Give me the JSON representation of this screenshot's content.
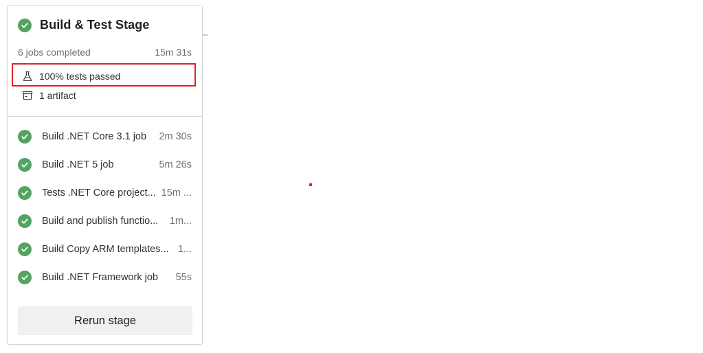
{
  "stage": {
    "title": "Build & Test Stage",
    "status": "succeeded",
    "summary": "6 jobs completed",
    "total_duration": "15m 31s",
    "tests_passed": "100% tests passed",
    "artifacts": "1 artifact"
  },
  "jobs": [
    {
      "name": "Build .NET Core 3.1 job",
      "duration": "2m 30s",
      "status": "succeeded"
    },
    {
      "name": "Build .NET 5 job",
      "duration": "5m 26s",
      "status": "succeeded"
    },
    {
      "name": "Tests .NET Core project...",
      "duration": "15m ...",
      "status": "succeeded"
    },
    {
      "name": "Build and publish functio...",
      "duration": "1m...",
      "status": "succeeded"
    },
    {
      "name": "Build Copy ARM templates...",
      "duration": "1...",
      "status": "succeeded"
    },
    {
      "name": "Build .NET Framework job",
      "duration": "55s",
      "status": "succeeded"
    }
  ],
  "actions": {
    "rerun_label": "Rerun stage"
  },
  "colors": {
    "success": "#55a362",
    "highlight": "#e0202a"
  },
  "icons": {
    "status": "check-circle-icon",
    "tests": "flask-icon",
    "artifact": "archive-box-icon"
  }
}
